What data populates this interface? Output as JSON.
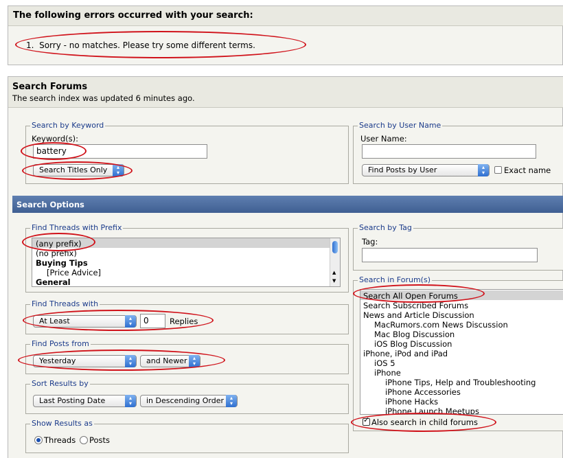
{
  "errors": {
    "title": "The following errors occurred with your search:",
    "number": "1.",
    "message": "Sorry - no matches. Please try some different terms."
  },
  "search_forums": {
    "title": "Search Forums",
    "subtitle": "The search index was updated 6 minutes ago."
  },
  "keyword": {
    "legend": "Search by Keyword",
    "label": "Keyword(s):",
    "value": "battery",
    "mode": "Search Titles Only"
  },
  "username": {
    "legend": "Search by User Name",
    "label": "User Name:",
    "value": "",
    "mode": "Find Posts by User",
    "exact_label": "Exact name"
  },
  "options_bar": "Search Options",
  "prefix": {
    "legend": "Find Threads with Prefix",
    "items": [
      "(any prefix)",
      "(no prefix)",
      "Buying Tips",
      "[Price Advice]",
      "General"
    ]
  },
  "threads_with": {
    "legend": "Find Threads with",
    "mode": "At Least",
    "count": "0",
    "suffix": "Replies"
  },
  "posts_from": {
    "legend": "Find Posts from",
    "when": "Yesterday",
    "direction": "and Newer"
  },
  "sort": {
    "legend": "Sort Results by",
    "field": "Last Posting Date",
    "order": "in Descending Order"
  },
  "show": {
    "legend": "Show Results as",
    "threads": "Threads",
    "posts": "Posts"
  },
  "tag": {
    "legend": "Search by Tag",
    "label": "Tag:",
    "value": ""
  },
  "forums": {
    "legend": "Search in Forum(s)",
    "items": [
      "Search All Open Forums",
      "Search Subscribed Forums",
      "News and Article Discussion",
      "MacRumors.com News Discussion",
      "Mac Blog Discussion",
      "iOS Blog Discussion",
      "iPhone, iPod and iPad",
      "iOS 5",
      "iPhone",
      "iPhone Tips, Help and Troubleshooting",
      "iPhone Accessories",
      "iPhone Hacks",
      "iPhone Launch Meetups"
    ],
    "child_label": "Also search in child forums"
  },
  "colors": {
    "annotation": "#d0121a",
    "legend": "#1a3a8a",
    "options_bar": "#4a6a9e"
  }
}
